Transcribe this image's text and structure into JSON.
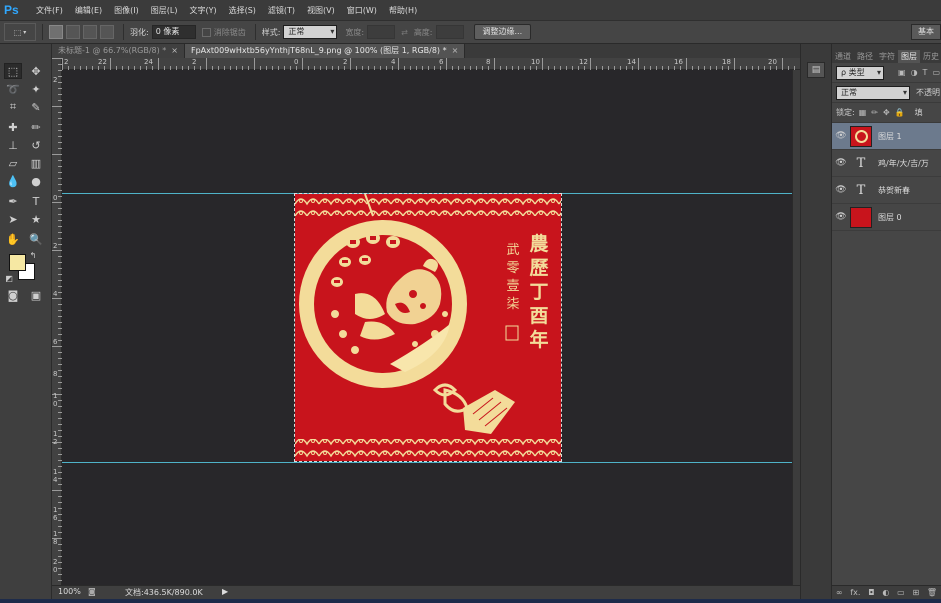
{
  "app": {
    "logo": "Ps"
  },
  "menu": [
    "文件(F)",
    "编辑(E)",
    "图像(I)",
    "图层(L)",
    "文字(Y)",
    "选择(S)",
    "滤镜(T)",
    "视图(V)",
    "窗口(W)",
    "帮助(H)"
  ],
  "options": {
    "feather_label": "羽化:",
    "feather_value": "0 像素",
    "antialias_label": "消除锯齿",
    "style_label": "样式:",
    "style_value": "正常",
    "width_label": "宽度:",
    "height_label": "高度:",
    "refine_edge": "调整边缘...",
    "workspace": "基本"
  },
  "tabs": [
    {
      "label": "未标题-1 @ 66.7%(RGB/8) *",
      "close": "×"
    },
    {
      "label": "FpAxt009wHxtb56yYnthjT68nL_9.png @ 100% (图层 1, RGB/8) *",
      "close": "×"
    }
  ],
  "ruler": {
    "h_labels": [
      "2",
      "0",
      "2",
      "4",
      "6",
      "8",
      "10",
      "12",
      "14",
      "16",
      "18",
      "20",
      "22",
      "24",
      "2"
    ],
    "v_labels": [
      "2",
      "0",
      "2",
      "4",
      "6",
      "8",
      "1",
      "0",
      "1",
      "2",
      "1",
      "4",
      "1",
      "6",
      "1",
      "8",
      "2",
      "0"
    ]
  },
  "status": {
    "zoom": "100%",
    "doc_info": "文档:436.5K/890.0K"
  },
  "panel": {
    "tabs": [
      "通道",
      "路径",
      "字符",
      "图层",
      "历史"
    ],
    "filter_kind": "类型",
    "blend_mode": "正常",
    "opacity_label": "不透明",
    "lock_label": "锁定:",
    "fill_label": "填",
    "layers": [
      {
        "name": "图层 1",
        "kind": "image"
      },
      {
        "name": "鸡/年/大/吉/万",
        "kind": "text",
        "icon": "T"
      },
      {
        "name": "恭贺新春",
        "kind": "text",
        "icon": "T"
      },
      {
        "name": "图层 0",
        "kind": "fill"
      }
    ],
    "footer_icons": [
      "∞",
      "fx.",
      "◘",
      "◐",
      "▭",
      "⊞",
      "🗑"
    ]
  },
  "artwork": {
    "title_text": [
      "農",
      "歷",
      "丁",
      "酉",
      "年"
    ],
    "side_text": [
      "武",
      "零",
      "壹",
      "柒"
    ],
    "colors": {
      "red": "#c8141c",
      "gold": "#f3dc9a"
    }
  }
}
